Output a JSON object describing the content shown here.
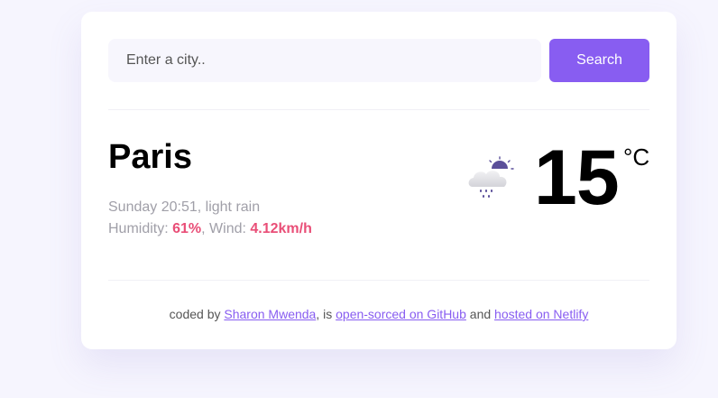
{
  "search": {
    "placeholder": "Enter a city..",
    "value": "",
    "button_label": "Search"
  },
  "weather": {
    "city": "Paris",
    "datetime": "Sunday 20:51",
    "description": "light rain",
    "humidity_label": "Humidity: ",
    "humidity": "61%",
    "wind_label": "Wind: ",
    "wind": "4.12km/h",
    "temperature": "15",
    "unit": "°C",
    "icon": "night-rain-cloud-icon"
  },
  "footer": {
    "prefix": "coded by ",
    "author_link": "Sharon Mwenda",
    "middle": ", is ",
    "github_link": "open-sorced on GitHub",
    "and": " and ",
    "netlify_link": "hosted on Netlify"
  },
  "colors": {
    "background": "#f6f5fe",
    "accent": "#885df1",
    "highlight": "#e94e77",
    "muted_text": "#a09fa8"
  }
}
